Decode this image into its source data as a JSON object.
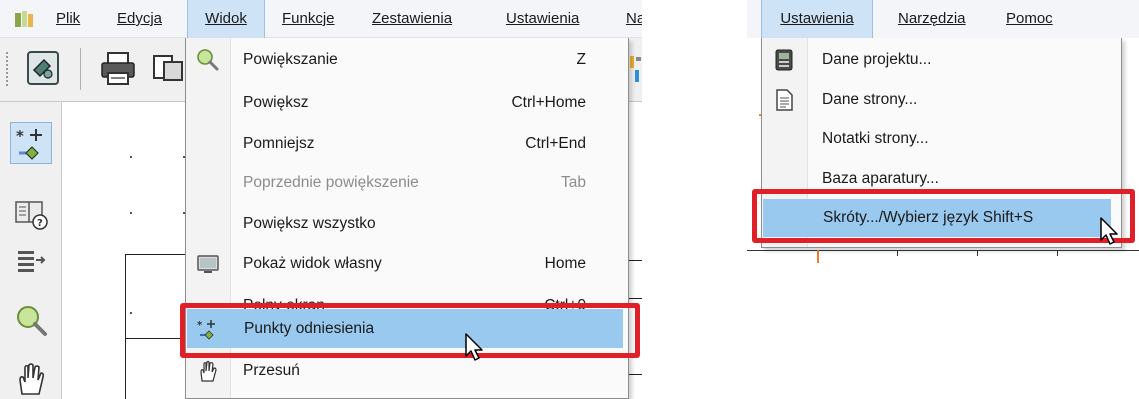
{
  "left_panel": {
    "menubar": {
      "items": [
        {
          "label": "Plik"
        },
        {
          "label": "Edycja"
        },
        {
          "label": "Widok"
        },
        {
          "label": "Funkcje"
        },
        {
          "label": "Zestawienia"
        },
        {
          "label": "Ustawienia"
        },
        {
          "label": "Na"
        }
      ],
      "active": "Widok"
    },
    "view_menu": {
      "items": [
        {
          "label": "Powiększanie",
          "shortcut": "Z",
          "icon": "magnifier-icon"
        },
        {
          "label": "Powiększ",
          "shortcut": "Ctrl+Home",
          "icon": ""
        },
        {
          "label": "Pomniejsz",
          "shortcut": "Ctrl+End",
          "icon": ""
        },
        {
          "label": "Poprzednie powiększenie",
          "shortcut": "Tab",
          "icon": "",
          "disabled": true
        },
        {
          "label": "Powiększ wszystko",
          "shortcut": "",
          "icon": ""
        },
        {
          "label": "Pokaż widok własny",
          "shortcut": "Home",
          "icon": "monitor-icon"
        },
        {
          "label": "Pełny ekran",
          "shortcut": "Ctrl+0",
          "icon": ""
        },
        {
          "label": "Punkty odniesienia",
          "shortcut": "",
          "icon": "reference-points-icon",
          "highlighted": true
        },
        {
          "label": "Przesuń",
          "shortcut": "",
          "icon": "hand-icon"
        }
      ]
    }
  },
  "right_panel": {
    "menubar": {
      "items": [
        {
          "label": "Ustawienia"
        },
        {
          "label": "Narzędzia"
        },
        {
          "label": "Pomoc"
        }
      ],
      "active": "Ustawienia"
    },
    "settings_menu": {
      "items": [
        {
          "label": "Dane projektu...",
          "icon": "project-data-icon"
        },
        {
          "label": "Dane strony...",
          "icon": "page-data-icon"
        },
        {
          "label": "Notatki strony...",
          "icon": ""
        },
        {
          "label": "Baza aparatury...",
          "icon": ""
        },
        {
          "label": "Skróty.../Wybierz język Shift+S",
          "icon": "",
          "highlighted": true
        }
      ]
    }
  },
  "colors": {
    "highlight": "#99c9ee",
    "annotation_box": "#e01f26",
    "menubar_bg": "#f3f5f8",
    "menu_bg": "#fafafa"
  }
}
